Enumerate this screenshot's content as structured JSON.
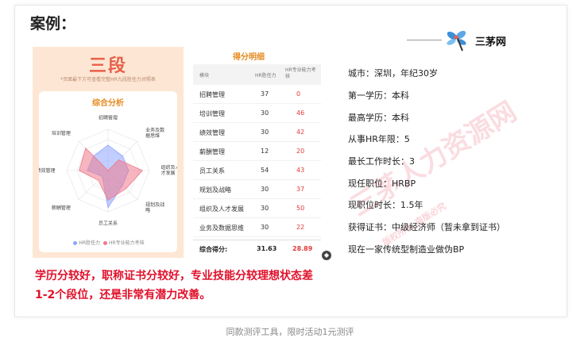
{
  "heading": "案例：",
  "brand": {
    "name": "三茅网"
  },
  "report": {
    "level": "三段",
    "subtitle": "*页面最下方可查看完整HR九段胜任力对照表",
    "radar_title": "综合分析",
    "radar_labels": [
      "招聘管理",
      "业务及数据思维",
      "组织及人才发展",
      "规划及战略",
      "员工关系",
      "薪酬管理",
      "绩效管理",
      "培训管理"
    ],
    "legend": [
      "HR胜任力",
      "HR专业能力考核"
    ],
    "legend_colors": [
      "#8ea6ff",
      "#f07a8a"
    ],
    "hr_competency": [
      37,
      30,
      30,
      30,
      54,
      12,
      30,
      30
    ],
    "professional": [
      0,
      22,
      50,
      37,
      43,
      20,
      42,
      46
    ]
  },
  "table": {
    "title": "得分明细",
    "headers": [
      "模块",
      "HR胜任力",
      "HR专业能力考核"
    ],
    "rows": [
      [
        "招聘管理",
        "37",
        "0"
      ],
      [
        "培训管理",
        "30",
        "46"
      ],
      [
        "绩效管理",
        "30",
        "42"
      ],
      [
        "薪酬管理",
        "12",
        "20"
      ],
      [
        "员工关系",
        "54",
        "43"
      ],
      [
        "规划及战略",
        "30",
        "37"
      ],
      [
        "组织及人才发展",
        "30",
        "50"
      ],
      [
        "业务及数据思维",
        "30",
        "22"
      ]
    ],
    "total_label": "综合得分:",
    "total_hr": "31.63",
    "total_pro": "28.89"
  },
  "info": [
    "城市：深圳，年纪30岁",
    "第一学历：本科",
    "最高学历：本科",
    "从事HR年限：5",
    "最长工作时长：3",
    "现任职位：HRBP",
    "现职位时长：1.5年",
    "获得证书：中级经济师（暂未拿到证书）",
    "现在一家传统型制造业做伪BP"
  ],
  "watermark": {
    "main": "三茅人力资源网",
    "sub": "版权所有 盗版必究"
  },
  "summary": "学历分较好，职称证书分较好，专业技能分较理想状态差1-2个段位，还是非常有潜力改善。",
  "caption": "同款测评工具，限时活动1元测评"
}
